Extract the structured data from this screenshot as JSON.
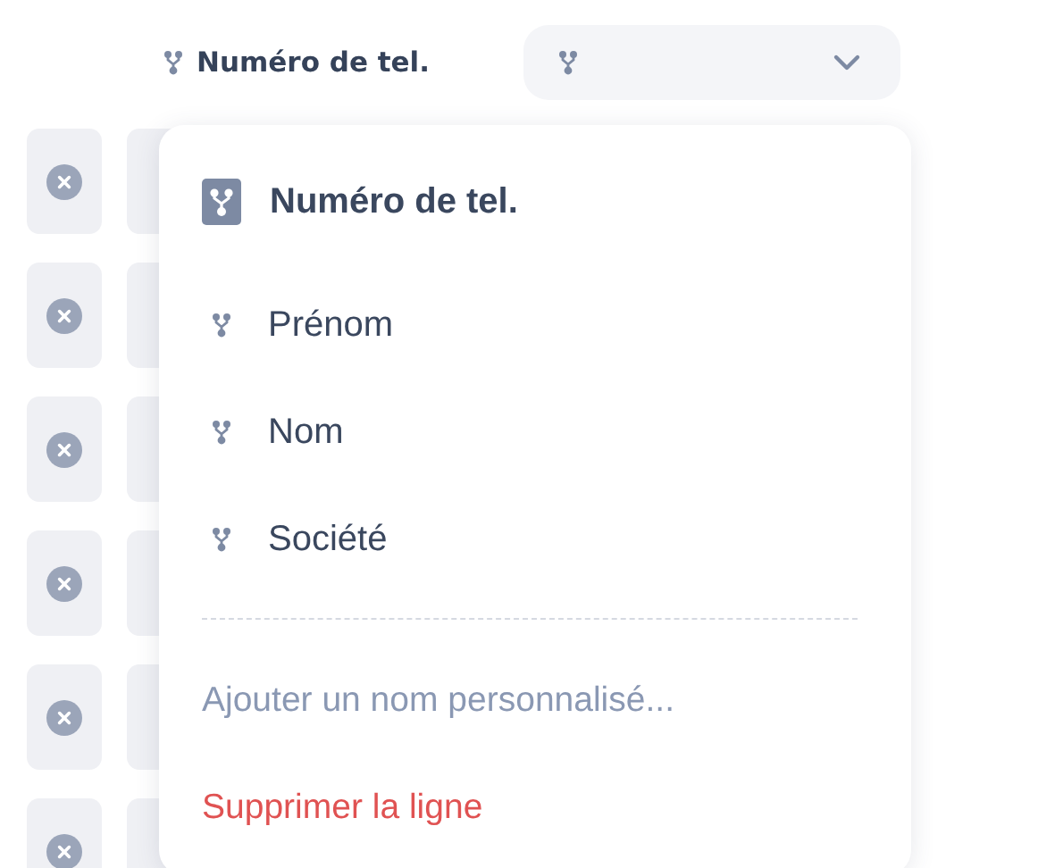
{
  "field": {
    "label": "Numéro de tel."
  },
  "dropdown": {
    "expanded": true
  },
  "menu": {
    "options": [
      {
        "label": "Numéro de tel.",
        "selected": true
      },
      {
        "label": "Prénom",
        "selected": false
      },
      {
        "label": "Nom",
        "selected": false
      },
      {
        "label": "Société",
        "selected": false
      }
    ],
    "actions": [
      {
        "label": "Ajouter un nom personnalisé...",
        "kind": "add"
      },
      {
        "label": "Supprimer la ligne",
        "kind": "delete"
      }
    ]
  }
}
